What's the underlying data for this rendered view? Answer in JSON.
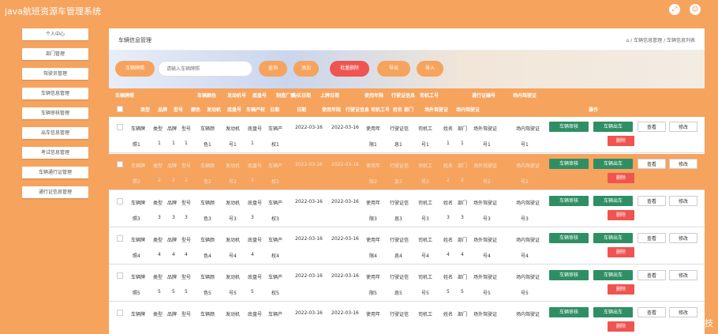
{
  "app": {
    "title": "java航班资源车管理系统",
    "fullscreen_icon": "fullscreen-icon",
    "user_icon": "user-icon"
  },
  "sidebar": {
    "items": [
      {
        "label": "个人中心"
      },
      {
        "label": "部门管理"
      },
      {
        "label": "驾驶员管理"
      },
      {
        "label": "车辆信息管理"
      },
      {
        "label": "车辆审核管理"
      },
      {
        "label": "出车信息管理"
      },
      {
        "label": "考试信息管理"
      },
      {
        "label": "车辆通行证管理"
      },
      {
        "label": "通行证信息管理"
      }
    ]
  },
  "breadcrumb": {
    "title": "车辆信息管理",
    "path": "⌂ / 车辆信息管理 / 车辆信息列表"
  },
  "search": {
    "label": "车辆牌照",
    "placeholder": "请输入车辆牌照",
    "query": "查询",
    "add": "添加",
    "batch_delete": "批量删除",
    "export": "导出",
    "import": "导入"
  },
  "table": {
    "group_headers": [
      "车辆牌照",
      "车辆颜色",
      "发动机号",
      "底盘号",
      "制造厂家",
      "购买日期",
      "上牌日期",
      "使用年限",
      "行驶证信息",
      "司机工号",
      "通行证编号",
      "场内驾驶证"
    ],
    "sub_headers": [
      "类型",
      "品牌",
      "型号",
      "颜色",
      "发动机",
      "底盘号",
      "车辆产权",
      "日期",
      "日期",
      "使用年限",
      "行驶证信息",
      "司机工号",
      "姓名",
      "部门",
      "场外驾驶证",
      "场内驾驶证",
      "操作"
    ],
    "rows": [
      {
        "plate": "车辆牌",
        "type": "类型",
        "brand": "品牌",
        "model": "型号",
        "color": "车辆颜",
        "engine": "发动机",
        "chassis": "底盘号",
        "owner": "车辆产",
        "buy_date": "2022-03-16",
        "reg_date": "2022-03-16",
        "years": "使用年",
        "license": "行驶证信",
        "driver": "司机工",
        "name": "姓名",
        "dept": "部门",
        "out_lic": "场外驾驶证",
        "in_lic": "场内驾驶证",
        "plate2": "照1",
        "type2": "1",
        "brand2": "1",
        "model2": "1",
        "color2": "色1",
        "engine2": "号1",
        "chassis2": "1",
        "owner2": "权1",
        "years2": "限1",
        "license2": "息1",
        "driver2": "号1",
        "name2": "1",
        "dept2": "1",
        "out2": "号1",
        "in2": "号1"
      },
      {
        "plate": "车辆牌",
        "type": "类型",
        "brand": "品牌",
        "model": "型号",
        "color": "车辆颜",
        "engine": "发动机",
        "chassis": "底盘号",
        "owner": "车辆产",
        "buy_date": "2022-03-16",
        "reg_date": "2022-03-16",
        "years": "使用年",
        "license": "行驶证信",
        "driver": "司机工",
        "name": "姓名",
        "dept": "部门",
        "out_lic": "场外驾驶证",
        "in_lic": "场内驾驶证",
        "plate2": "照2",
        "type2": "2",
        "brand2": "2",
        "model2": "2",
        "color2": "色2",
        "engine2": "号2",
        "chassis2": "2",
        "owner2": "权2",
        "years2": "限2",
        "license2": "息2",
        "driver2": "号2",
        "name2": "2",
        "dept2": "2",
        "out2": "号2",
        "in2": "号2"
      },
      {
        "plate": "车辆牌",
        "type": "类型",
        "brand": "品牌",
        "model": "型号",
        "color": "车辆颜",
        "engine": "发动机",
        "chassis": "底盘号",
        "owner": "车辆产",
        "buy_date": "2022-03-16",
        "reg_date": "2022-03-16",
        "years": "使用年",
        "license": "行驶证信",
        "driver": "司机工",
        "name": "姓名",
        "dept": "部门",
        "out_lic": "场外驾驶证",
        "in_lic": "场内驾驶证",
        "plate2": "照3",
        "type2": "3",
        "brand2": "3",
        "model2": "3",
        "color2": "色3",
        "engine2": "号3",
        "chassis2": "3",
        "owner2": "权3",
        "years2": "限3",
        "license2": "息3",
        "driver2": "号3",
        "name2": "3",
        "dept2": "3",
        "out2": "号3",
        "in2": "号3"
      },
      {
        "plate": "车辆牌",
        "type": "类型",
        "brand": "品牌",
        "model": "型号",
        "color": "车辆颜",
        "engine": "发动机",
        "chassis": "底盘号",
        "owner": "车辆产",
        "buy_date": "2022-03-16",
        "reg_date": "2022-03-16",
        "years": "使用年",
        "license": "行驶证信",
        "driver": "司机工",
        "name": "姓名",
        "dept": "部门",
        "out_lic": "场外驾驶证",
        "in_lic": "场内驾驶证",
        "plate2": "照4",
        "type2": "4",
        "brand2": "4",
        "model2": "4",
        "color2": "色4",
        "engine2": "号4",
        "chassis2": "4",
        "owner2": "权4",
        "years2": "限4",
        "license2": "息4",
        "driver2": "号4",
        "name2": "4",
        "dept2": "4",
        "out2": "号4",
        "in2": "号4"
      },
      {
        "plate": "车辆牌",
        "type": "类型",
        "brand": "品牌",
        "model": "型号",
        "color": "车辆颜",
        "engine": "发动机",
        "chassis": "底盘号",
        "owner": "车辆产",
        "buy_date": "2022-03-16",
        "reg_date": "2022-03-16",
        "years": "使用年",
        "license": "行驶证信",
        "driver": "司机工",
        "name": "姓名",
        "dept": "部门",
        "out_lic": "场外驾驶证",
        "in_lic": "场内驾驶证",
        "plate2": "照5",
        "type2": "5",
        "brand2": "5",
        "model2": "5",
        "color2": "色5",
        "engine2": "号5",
        "chassis2": "5",
        "owner2": "权5",
        "years2": "限5",
        "license2": "息5",
        "driver2": "号5",
        "name2": "5",
        "dept2": "5",
        "out2": "号5",
        "in2": "号5"
      },
      {
        "plate": "车辆牌",
        "type": "类型",
        "brand": "品牌",
        "model": "型号",
        "color": "车辆颜",
        "engine": "发动机",
        "chassis": "底盘号",
        "owner": "车辆产",
        "buy_date": "2022-03-16",
        "reg_date": "2022-03-16",
        "years": "使用年",
        "license": "行驶证信",
        "driver": "司机工",
        "name": "姓名",
        "dept": "部门",
        "out_lic": "场外驾驶证",
        "in_lic": "场内驾驶证",
        "plate2": "",
        "type2": "",
        "brand2": "",
        "model2": "",
        "color2": "",
        "engine2": "",
        "chassis2": "",
        "owner2": "",
        "years2": "",
        "license2": "",
        "driver2": "",
        "name2": "",
        "dept2": "",
        "out2": "",
        "in2": ""
      }
    ],
    "actions": {
      "audit": "车辆审核",
      "dispatch": "车辆出车",
      "view": "查看",
      "edit": "修改",
      "delete": "删除"
    }
  },
  "watermark": "CSDN @李会科技",
  "colors": {
    "accent": "#f6a35e",
    "danger": "#ef5450",
    "success": "#2f8f64"
  }
}
